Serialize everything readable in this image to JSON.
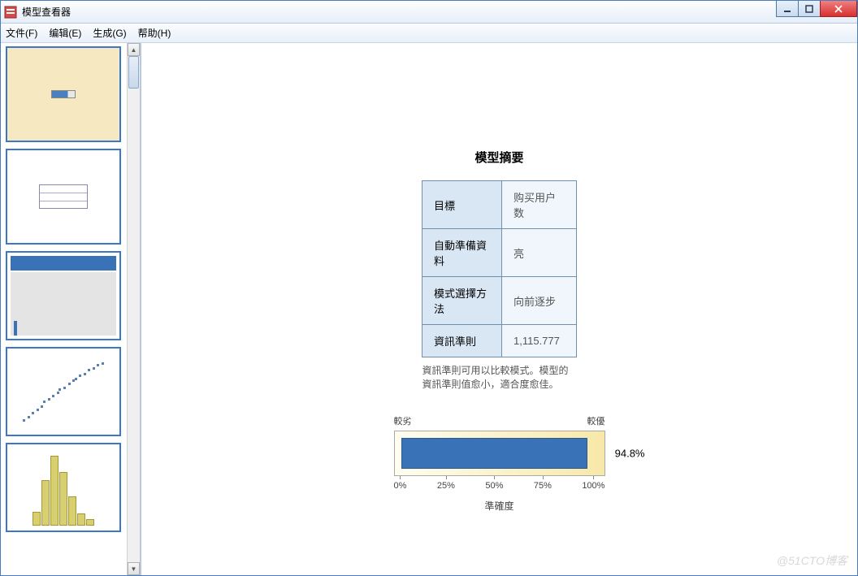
{
  "window": {
    "title": "模型查看器"
  },
  "menu": {
    "file": "文件(F)",
    "edit": "编辑(E)",
    "generate": "生成(G)",
    "help": "帮助(H)"
  },
  "summary": {
    "title": "模型摘要",
    "rows": [
      {
        "label": "目標",
        "value": "购买用户数"
      },
      {
        "label": "自動準備資料",
        "value": "亮"
      },
      {
        "label": "模式選擇方法",
        "value": "向前逐步"
      },
      {
        "label": "資訊準則",
        "value": "1,115.777"
      }
    ],
    "footnote": "資訊準則可用以比較模式。模型的資訊準則值愈小，適合度愈佳。"
  },
  "accuracy": {
    "worse_label": "較劣",
    "better_label": "較優",
    "value_label": "94.8%",
    "axis_label": "準確度",
    "ticks": [
      "0%",
      "25%",
      "50%",
      "75%",
      "100%"
    ]
  },
  "chart_data": {
    "type": "bar",
    "title": "準確度",
    "categories": [
      "準確度"
    ],
    "values": [
      94.8
    ],
    "xlabel": "準確度",
    "ylabel": "",
    "ylim": [
      0,
      100
    ],
    "orientation": "horizontal",
    "scale_labels": {
      "low": "較劣",
      "high": "較優"
    }
  },
  "watermark": "@51CTO博客"
}
